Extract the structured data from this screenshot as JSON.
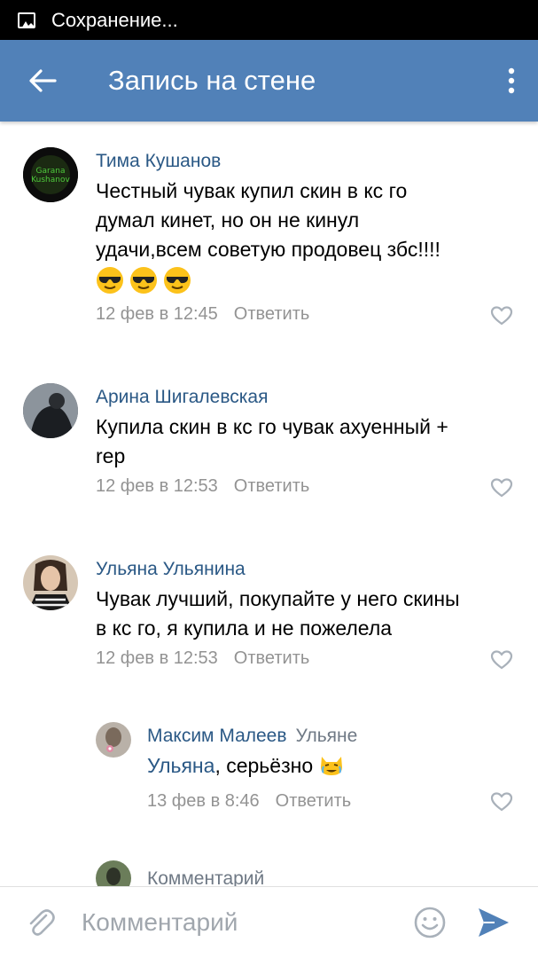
{
  "status_bar": {
    "text": "Сохранение..."
  },
  "header": {
    "title": "Запись на стене"
  },
  "comments": [
    {
      "author": "Тима Кушанов",
      "lines": [
        "Честный чувак купил скин в кс го",
        "думал кинет,  но он не кинул",
        "удачи,всем советую продовец збс!!!!"
      ],
      "emoji": [
        "😎",
        "😎",
        "😎"
      ],
      "date": "12 фев в 12:45",
      "reply": "Ответить"
    },
    {
      "author": "Арина Шигалевская",
      "lines": [
        "Купила скин в  кс го чувак ахуенный +",
        "rep"
      ],
      "date": "12 фев в 12:53",
      "reply": "Ответить"
    },
    {
      "author": "Ульяна Ульянина",
      "lines": [
        "Чувак лучший, покупайте у него скины",
        "в кс го, я купила и не пожелела"
      ],
      "date": "12 фев в 12:53",
      "reply": "Ответить"
    },
    {
      "author": "Максим Малеев",
      "reply_to": "Ульяне",
      "mention": "Ульяна",
      "text_rest": ", серьёзно",
      "emoji": "😹",
      "date": "13 фев в 8:46",
      "reply": "Ответить"
    },
    {
      "author": "Комментарий"
    }
  ],
  "composer": {
    "placeholder": "Комментарий"
  },
  "colors": {
    "header": "#5181b8",
    "link": "#2a5885",
    "meta": "#939393"
  }
}
